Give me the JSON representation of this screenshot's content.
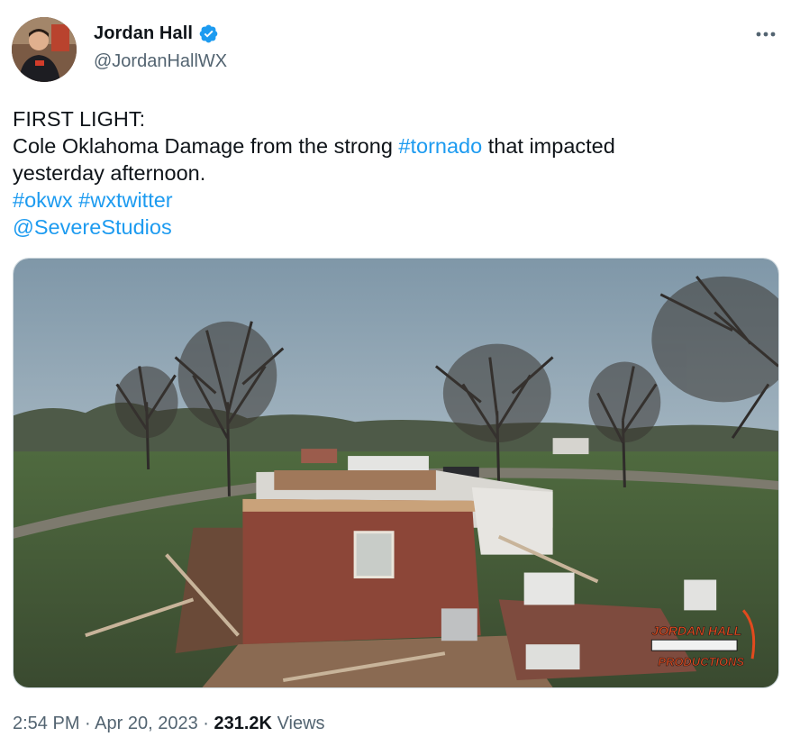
{
  "author": {
    "display_name": "Jordan Hall",
    "handle": "@JordanHallWX",
    "verified": true,
    "avatar": "profile-photo"
  },
  "tweet": {
    "line1": "FIRST LIGHT:",
    "line2_pre": "Cole Oklahoma Damage from the strong ",
    "line2_link": "#tornado",
    "line2_post": " that impacted",
    "line3": "yesterday afternoon.",
    "hashtag1": "#okwx",
    "hashtag2": "#wxtwitter",
    "mention": "@SevereStudios"
  },
  "media": {
    "description_icon": "video-thumbnail",
    "watermark_line1": "JORDAN HALL",
    "watermark_line2": "PRODUCTIONS"
  },
  "meta": {
    "time": "2:54 PM",
    "separator": "·",
    "date": "Apr 20, 2023",
    "views_count": "231.2K",
    "views_label": "Views"
  },
  "colors": {
    "link": "#1d9bf0",
    "verified": "#1d9bf0",
    "secondary_text": "#536471",
    "primary_text": "#0f1419"
  },
  "icons": {
    "verified": "verified-badge-icon",
    "more": "more-options-icon"
  }
}
